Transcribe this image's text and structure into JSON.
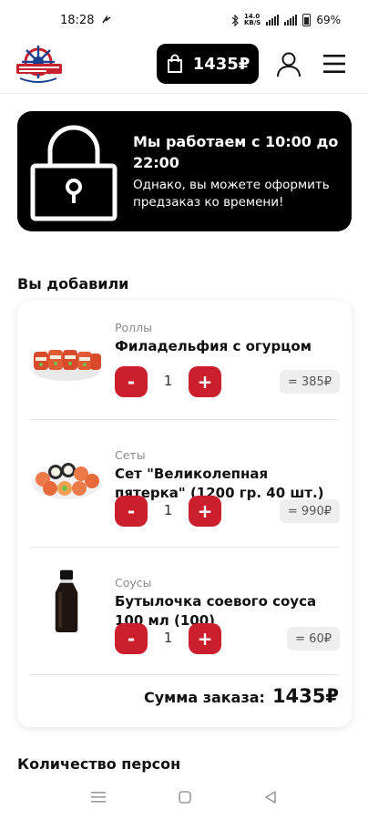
{
  "status_bar": {
    "time": "18:28",
    "battery": "69%",
    "network_speed": "14.0\nKB/S"
  },
  "header": {
    "logo_icon": "ship-wheel-logo-icon",
    "cart_total": "1435₽",
    "cart_icon": "shopping-bag-icon",
    "profile_icon": "user-icon",
    "menu_icon": "hamburger-menu-icon"
  },
  "banner": {
    "icon": "padlock-icon",
    "title": "Мы работаем с 10:00 до 22:00",
    "subtitle": "Однако, вы можете оформить предзаказ ко времени!"
  },
  "cart": {
    "title": "Вы добавили",
    "items": [
      {
        "category": "Роллы",
        "name": "Филадельфия с огурцом",
        "quantity": "1",
        "price": "= 385₽",
        "minus_label": "-",
        "plus_label": "+"
      },
      {
        "category": "Сеты",
        "name": "Сет \"Великолепная пятерка\" (1200 гр. 40 шт.)",
        "quantity": "1",
        "price": "= 990₽",
        "minus_label": "-",
        "plus_label": "+"
      },
      {
        "category": "Соусы",
        "name": "Бутылочка соевого соуса 100 мл (100)",
        "quantity": "1",
        "price": "= 60₽",
        "minus_label": "-",
        "plus_label": "+"
      }
    ],
    "total_label": "Сумма заказа:",
    "total_value": "1435₽"
  },
  "persons": {
    "title": "Количество персон"
  },
  "colors": {
    "accent_red": "#cc1f2e",
    "black": "#000000",
    "price_bg": "#eeeeee"
  }
}
